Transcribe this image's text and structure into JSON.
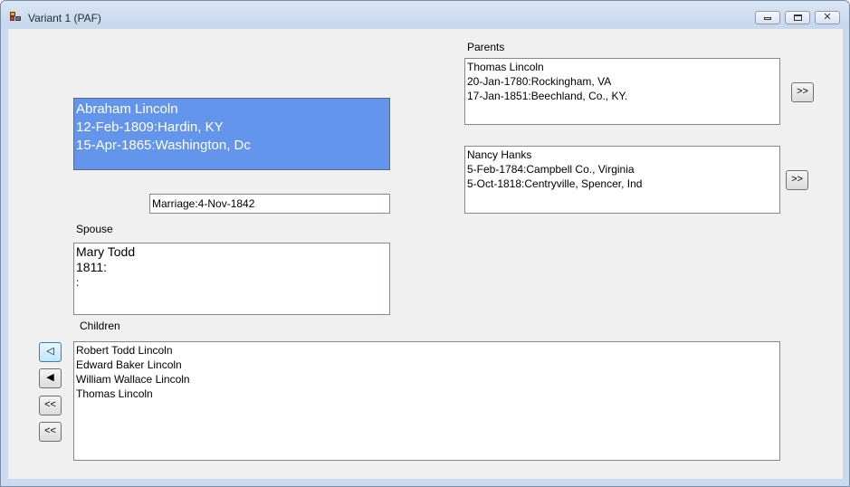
{
  "window": {
    "title": "Variant 1 (PAF)"
  },
  "person": {
    "name": "Abraham Lincoln",
    "birth": "12-Feb-1809:Hardin, KY",
    "death": "15-Apr-1865:Washington, Dc"
  },
  "marriage": "Marriage:4-Nov-1842",
  "spouse": {
    "label": "Spouse",
    "name": "Mary Todd",
    "birth": "1811:",
    "death": ":"
  },
  "parents": {
    "label": "Parents",
    "father": {
      "name": "Thomas Lincoln",
      "birth": "20-Jan-1780:Rockingham, VA",
      "death": "17-Jan-1851:Beechland, Co., KY."
    },
    "mother": {
      "name": "Nancy Hanks",
      "birth": "5-Feb-1784:Campbell Co., Virginia",
      "death": "5-Oct-1818:Centryville, Spencer, Ind"
    },
    "father_nav": ">>",
    "mother_nav": ">>"
  },
  "children": {
    "label": "Children",
    "items": [
      "Robert Todd Lincoln",
      "Edward Baker Lincoln",
      "William Wallace Lincoln",
      "Thomas Lincoln"
    ]
  },
  "left_buttons": [
    "◁",
    "◀",
    "<<",
    "<<"
  ],
  "colors": {
    "selected_person_bg": "#6495ed",
    "client_bg": "#f0f0f0"
  }
}
